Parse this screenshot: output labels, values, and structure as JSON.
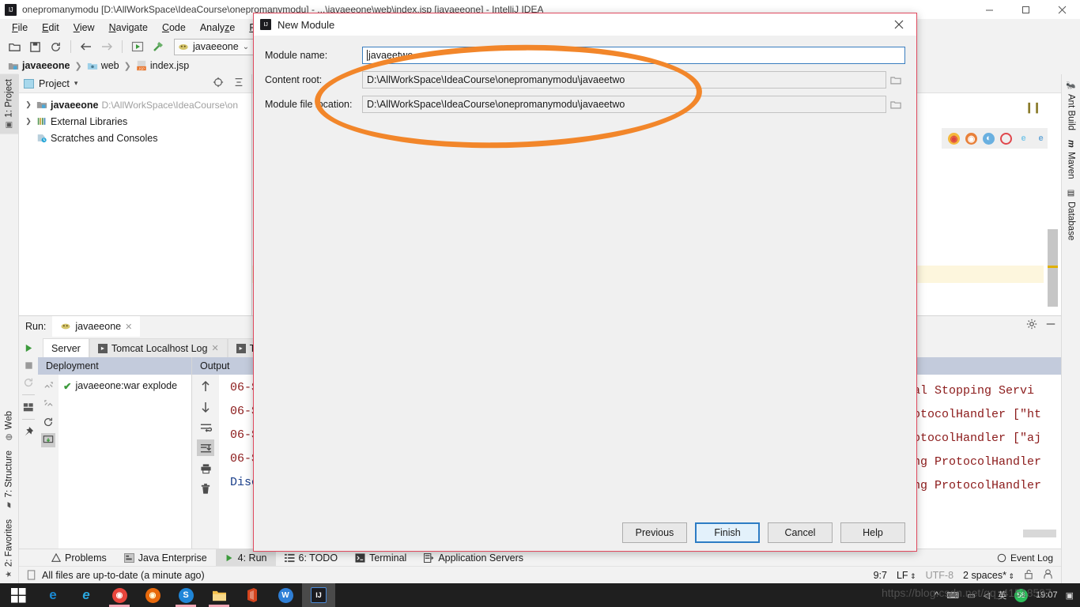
{
  "window": {
    "title": "onepromanymodu [D:\\AllWorkSpace\\IdeaCourse\\onepromanymodu] - ...\\javaeeone\\web\\index.jsp [javaeeone] - IntelliJ IDEA",
    "minimize": "—",
    "maximize": "▢",
    "close": "✕"
  },
  "menu": {
    "items": [
      {
        "label": "File",
        "mnemonic": "F"
      },
      {
        "label": "Edit",
        "mnemonic": "E"
      },
      {
        "label": "View",
        "mnemonic": "V"
      },
      {
        "label": "Navigate",
        "mnemonic": "N"
      },
      {
        "label": "Code",
        "mnemonic": "C"
      },
      {
        "label": "Analyze",
        "mnemonic": "z"
      },
      {
        "label": "Refacto",
        "mnemonic": "R"
      }
    ]
  },
  "toolbar": {
    "open_icon": "open-folder-icon",
    "save_icon": "save-icon",
    "sync_icon": "sync-icon",
    "back_icon": "back-arrow-icon",
    "forward_icon": "forward-arrow-icon",
    "run_icon": "run-icon",
    "build_icon": "build-hammer-icon",
    "run_config": "javaeeone",
    "dropdown": "⌄"
  },
  "breadcrumb": {
    "items": [
      "javaeeone",
      "web",
      "index.jsp"
    ],
    "separator": "❯"
  },
  "left_rail": {
    "top": [
      {
        "label": "1: Project",
        "icon": "project-icon"
      }
    ],
    "bottom": [
      {
        "label": "Web",
        "icon": "globe-icon"
      },
      {
        "label": "7: Structure",
        "icon": "structure-icon"
      },
      {
        "label": "2: Favorites",
        "icon": "star-icon"
      }
    ]
  },
  "project_panel": {
    "header": "Project",
    "dropdown": "▾",
    "locate_icon": "crosshair-icon",
    "collapse_icon": "collapse-all-icon",
    "tree": [
      {
        "label": "javaeeone",
        "path": "D:\\AllWorkSpace\\IdeaCourse\\on",
        "arrow": "❯",
        "bold": true,
        "icon": "module-folder-icon"
      },
      {
        "label": "External Libraries",
        "path": "",
        "arrow": "❯",
        "bold": false,
        "icon": "libraries-icon"
      },
      {
        "label": "Scratches and Consoles",
        "path": "",
        "arrow": "",
        "bold": false,
        "icon": "scratches-icon"
      }
    ]
  },
  "editor": {
    "browsers": [
      "chrome-icon",
      "firefox-icon",
      "safari-icon",
      "opera-icon",
      "ie-icon",
      "edge-icon"
    ],
    "pause_icon": "pause-icon"
  },
  "run_panel": {
    "label": "Run:",
    "tab": "javaeeone",
    "tab_close": "✕",
    "settings_icon": "gear-icon",
    "minimize_icon": "minimize-icon",
    "side_tools": [
      {
        "icon": "run-icon",
        "name": "rerun-button"
      },
      {
        "icon": "stop-icon",
        "name": "stop-button"
      },
      {
        "icon": "restart-icon",
        "name": "restart-button"
      },
      {
        "icon": "layout-icon",
        "name": "layout-button"
      },
      {
        "icon": "pin-icon",
        "name": "pin-button"
      }
    ],
    "server_tabs": [
      {
        "label": "Server",
        "active": true,
        "has_icon": false,
        "closable": false
      },
      {
        "label": "Tomcat Localhost Log",
        "active": false,
        "has_icon": true,
        "closable": true
      },
      {
        "label": "Tomca",
        "active": false,
        "has_icon": true,
        "closable": false
      }
    ],
    "deployment": {
      "header": "Deployment",
      "tools": [
        "expand-icon",
        "collapse-icon",
        "refresh-icon",
        "deploy-icon"
      ],
      "items": [
        {
          "check": "✔",
          "label": "javaeeone:war explode"
        }
      ]
    },
    "output": {
      "header": "Output",
      "tools": [
        "up-arrow-icon",
        "down-arrow-icon",
        "soft-wrap-icon",
        "scroll-to-end-icon",
        "print-icon",
        "trash-icon"
      ],
      "lines_left": [
        "06-S",
        "06-S",
        "06-S",
        "06-S",
        "Disc"
      ],
      "lines_right": [
        "al Stopping Servi",
        "otocolHandler [\"ht",
        "otocolHandler [\"aj",
        "ng ProtocolHandler",
        "ng ProtocolHandler"
      ]
    }
  },
  "bottom_strip": {
    "items": [
      {
        "label": "Problems",
        "icon": "warning-icon",
        "selected": false,
        "mnemonic": ""
      },
      {
        "label": "Java Enterprise",
        "icon": "java-ee-icon",
        "selected": false,
        "mnemonic": ""
      },
      {
        "label": "4: Run",
        "icon": "run-icon",
        "selected": true,
        "mnemonic": "4"
      },
      {
        "label": "6: TODO",
        "icon": "todo-icon",
        "selected": false,
        "mnemonic": "6"
      },
      {
        "label": "Terminal",
        "icon": "terminal-icon",
        "selected": false,
        "mnemonic": ""
      },
      {
        "label": "Application Servers",
        "icon": "app-servers-icon",
        "selected": false,
        "mnemonic": ""
      }
    ],
    "event_log": "Event Log",
    "event_log_icon": "event-log-icon"
  },
  "status_bar": {
    "sync_icon": "file-sync-icon",
    "message": "All files are up-to-date (a minute ago)",
    "caret": "9:7",
    "line_sep": "LF",
    "line_sep_arrow": "⇕",
    "encoding": "UTF-8",
    "indent": "2 spaces*",
    "indent_arrow": "⇕",
    "lock_icon": "unlock-icon",
    "inspect_icon": "inspection-icon"
  },
  "right_rail": [
    {
      "label": "Ant Build",
      "icon": "ant-icon"
    },
    {
      "label": "Maven",
      "icon": "maven-m-icon"
    },
    {
      "label": "Database",
      "icon": "database-icon"
    }
  ],
  "dialog": {
    "title": "New Module",
    "icon": "intellij-icon",
    "close": "✕",
    "fields": [
      {
        "label": "Module name:",
        "value": "javaeetwo",
        "focused": true,
        "has_browse": false
      },
      {
        "label": "Content root:",
        "value": "D:\\AllWorkSpace\\IdeaCourse\\onepromanymodu\\javaeetwo",
        "focused": false,
        "has_browse": true
      },
      {
        "label": "Module file location:",
        "value": "D:\\AllWorkSpace\\IdeaCourse\\onepromanymodu\\javaeetwo",
        "focused": false,
        "has_browse": true
      }
    ],
    "buttons": [
      {
        "label": "Previous",
        "default": false
      },
      {
        "label": "Finish",
        "default": true
      },
      {
        "label": "Cancel",
        "default": false
      },
      {
        "label": "Help",
        "default": false
      }
    ]
  },
  "annotation": {
    "shape": "ellipse",
    "color": "#f2862a"
  },
  "taskbar": {
    "start_icon": "windows-start-icon",
    "apps": [
      {
        "name": "edge-icon",
        "glyph": "e",
        "color": "#1a8ad4",
        "bg": "transparent",
        "active": false,
        "underline": false
      },
      {
        "name": "ie-icon",
        "glyph": "e",
        "color": "#2aa8e0",
        "bg": "transparent",
        "active": false,
        "underline": false
      },
      {
        "name": "chrome-icon",
        "glyph": "◉",
        "color": "#e8453c",
        "bg": "transparent",
        "active": false,
        "underline": true
      },
      {
        "name": "firefox-icon",
        "glyph": "◉",
        "color": "#e8690b",
        "bg": "transparent",
        "active": false,
        "underline": false
      },
      {
        "name": "sogou-icon",
        "glyph": "S",
        "color": "#ffffff",
        "bg": "#1f86d8",
        "active": false,
        "underline": true
      },
      {
        "name": "file-explorer-icon",
        "glyph": "▬",
        "color": "#f5c04a",
        "bg": "transparent",
        "active": false,
        "underline": true
      },
      {
        "name": "office-icon",
        "glyph": "▯",
        "color": "#d4441e",
        "bg": "transparent",
        "active": false,
        "underline": false
      },
      {
        "name": "wps-icon",
        "glyph": "W",
        "color": "#ffffff",
        "bg": "#2f7fd6",
        "active": false,
        "underline": false
      },
      {
        "name": "intellij-idea-icon",
        "glyph": "IJ",
        "color": "#ffffff",
        "bg": "#1b1b1f",
        "active": true,
        "underline": false
      }
    ],
    "tray": {
      "up_icon": "^",
      "items": [
        "keyboard-icon",
        "monitor-icon",
        "volume-icon"
      ],
      "ime": "英",
      "badge": "58",
      "time": "19:07",
      "notify_icon": "notification-icon"
    },
    "watermark": "https://blog.csdn.net/qq_41518597"
  }
}
